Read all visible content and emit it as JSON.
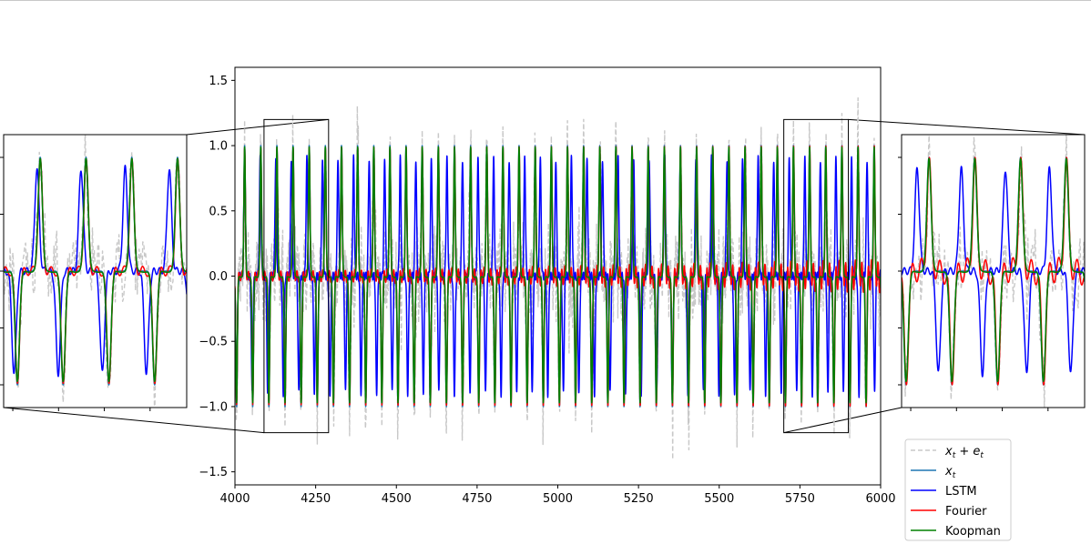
{
  "chart_data": {
    "type": "line",
    "title": "",
    "xlabel": "",
    "ylabel": "",
    "xlim": [
      4000,
      6000
    ],
    "ylim": [
      -1.6,
      1.6
    ],
    "x_ticks": [
      4000,
      4250,
      4500,
      4750,
      5000,
      5250,
      5500,
      5750,
      6000
    ],
    "x_tick_labels": [
      "4000",
      "4250",
      "4500",
      "4750",
      "5000",
      "5250",
      "5500",
      "5750",
      "6000"
    ],
    "y_ticks": [
      1.5,
      1.0,
      0.5,
      0.0,
      -0.5,
      -1.0,
      -1.5
    ],
    "y_tick_labels": [
      "1.5",
      "1.0",
      "0.5",
      "0.0",
      "−0.5",
      "−1.0",
      "−1.5"
    ],
    "grid": false,
    "legend_position": "lower-right, outside axes",
    "signal": {
      "period": 50.0,
      "first_positive_peak": 4030,
      "first_negative_peak": 4005,
      "peak_value": 1.0,
      "trough_value": -1.0,
      "lstm_period": 48.2
    },
    "series": [
      {
        "name": "x_t + e_t",
        "legend_main": "x",
        "legend_sub": "t",
        "legend_rest": " + e",
        "legend_sub2": "t",
        "color": "#c8c8c8",
        "style": "dashed"
      },
      {
        "name": "x_t",
        "legend_main": "x",
        "legend_sub": "t",
        "color": "#1f77b4",
        "style": "solid"
      },
      {
        "name": "LSTM",
        "color": "#0000ff",
        "style": "solid"
      },
      {
        "name": "Fourier",
        "color": "#ff0000",
        "style": "solid"
      },
      {
        "name": "Koopman",
        "color": "#008000",
        "style": "solid"
      }
    ],
    "zoom_windows": [
      {
        "position": "left",
        "xlim": [
          4090,
          4290
        ],
        "ylim": [
          -1.2,
          1.2
        ]
      },
      {
        "position": "right",
        "xlim": [
          5700,
          5900
        ],
        "ylim": [
          -1.2,
          1.2
        ]
      }
    ]
  }
}
